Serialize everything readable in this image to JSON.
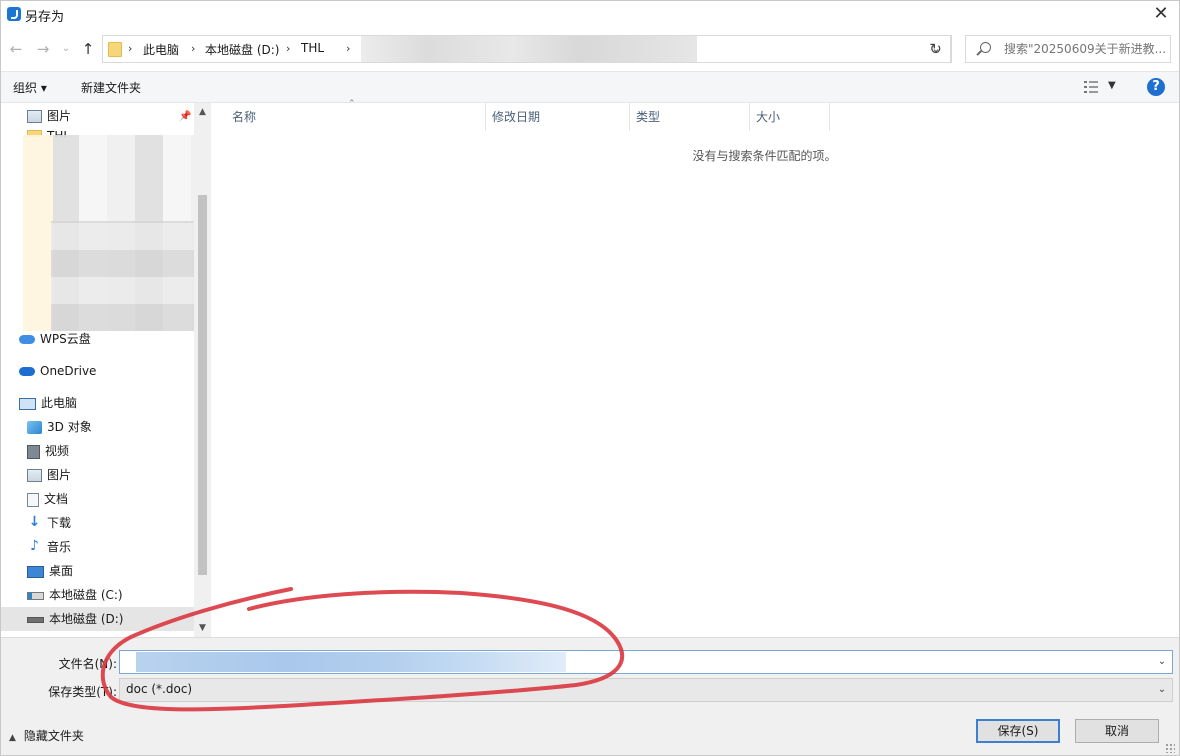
{
  "window": {
    "title": "另存为"
  },
  "address": {
    "crumbs": [
      "此电脑",
      "本地磁盘 (D:)",
      "THL"
    ],
    "separator": "›"
  },
  "search": {
    "placeholder": "搜索\"20250609关于新进教..."
  },
  "toolbar": {
    "organize": "组织 ▾",
    "new_folder": "新建文件夹",
    "help": "?"
  },
  "sidebar": {
    "items": [
      {
        "label": "图片",
        "icon": "pictures-icon"
      },
      {
        "label": "THL",
        "icon": "folder-icon"
      },
      {
        "label": "WPS云盘",
        "icon": "wps-cloud-icon"
      },
      {
        "label": "OneDrive",
        "icon": "onedrive-icon"
      },
      {
        "label": "此电脑",
        "icon": "this-pc-icon"
      },
      {
        "label": "3D 对象",
        "icon": "3d-objects-icon"
      },
      {
        "label": "视频",
        "icon": "videos-icon"
      },
      {
        "label": "图片",
        "icon": "pictures-icon"
      },
      {
        "label": "文档",
        "icon": "documents-icon"
      },
      {
        "label": "下载",
        "icon": "downloads-icon"
      },
      {
        "label": "音乐",
        "icon": "music-icon"
      },
      {
        "label": "桌面",
        "icon": "desktop-icon"
      },
      {
        "label": "本地磁盘 (C:)",
        "icon": "drive-c-icon"
      },
      {
        "label": "本地磁盘 (D:)",
        "icon": "drive-d-icon",
        "selected": true
      }
    ]
  },
  "columns": {
    "name": "名称",
    "modified": "修改日期",
    "type": "类型",
    "size": "大小"
  },
  "main": {
    "empty_message": "没有与搜索条件匹配的项。"
  },
  "form": {
    "filename_label": "文件名(N):",
    "filename_value": "",
    "filetype_label": "保存类型(T):",
    "filetype_value": "doc (*.doc)"
  },
  "footer": {
    "hide_folders": "隐藏文件夹",
    "save": "保存(S)",
    "cancel": "取消"
  },
  "colors": {
    "accent": "#1e6fd0",
    "annotation": "#d9363e",
    "selected_row": "#e5e5e5"
  }
}
